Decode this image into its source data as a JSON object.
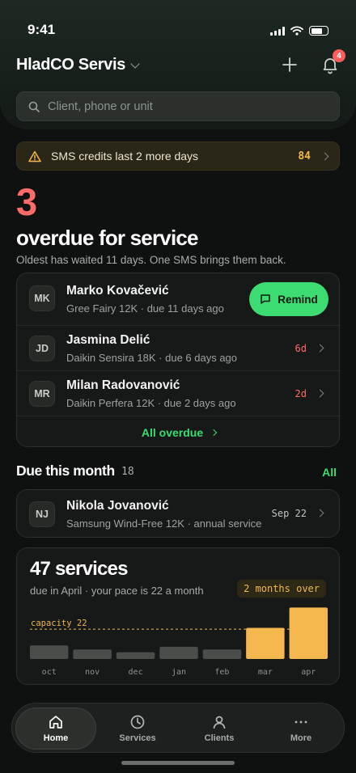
{
  "status": {
    "time": "9:41"
  },
  "header": {
    "title": "HladCO Servis",
    "notification_count": "4",
    "search_placeholder": "Client, phone or unit"
  },
  "sms_banner": {
    "text": "SMS credits last 2 more days",
    "count": "84"
  },
  "overdue": {
    "count": "3",
    "title": "overdue for service",
    "subtitle": "Oldest has waited 11 days. One SMS brings them back.",
    "remind_label": "Remind",
    "all_label": "All overdue",
    "items": [
      {
        "initials": "MK",
        "name": "Marko Kovačević",
        "detail": "Gree Fairy 12K · due 11 days ago"
      },
      {
        "initials": "JD",
        "name": "Jasmina Delić",
        "detail": "Daikin Sensira 18K · due 6 days ago",
        "days": "6d"
      },
      {
        "initials": "MR",
        "name": "Milan Radovanović",
        "detail": "Daikin Perfera 12K · due 2 days ago",
        "days": "2d"
      }
    ]
  },
  "due_month": {
    "title": "Due this month",
    "count": "18",
    "link": "All",
    "item": {
      "initials": "NJ",
      "name": "Nikola Jovanović",
      "detail": "Samsung Wind-Free 12K · annual service",
      "date": "Sep 22"
    }
  },
  "services": {
    "title": "47 services",
    "subtitle": "due in April · your pace is 22 a month",
    "pill": "2 months over",
    "chart_data": {
      "type": "bar",
      "categories": [
        "oct",
        "nov",
        "dec",
        "jan",
        "feb",
        "mar",
        "apr"
      ],
      "values": [
        10,
        7,
        5,
        9,
        7,
        23,
        38
      ],
      "capacity": 22,
      "capacity_label": "capacity 22",
      "ylim": [
        0,
        40
      ],
      "colors": {
        "normal": "#4a4e4b",
        "over": "#f5b84f",
        "capacity_line": "#f2b84b"
      }
    }
  },
  "tabs": [
    {
      "label": "Home",
      "icon": "home-icon",
      "active": true
    },
    {
      "label": "Services",
      "icon": "clock-icon"
    },
    {
      "label": "Clients",
      "icon": "user-icon"
    },
    {
      "label": "More",
      "icon": "more-icon"
    }
  ]
}
